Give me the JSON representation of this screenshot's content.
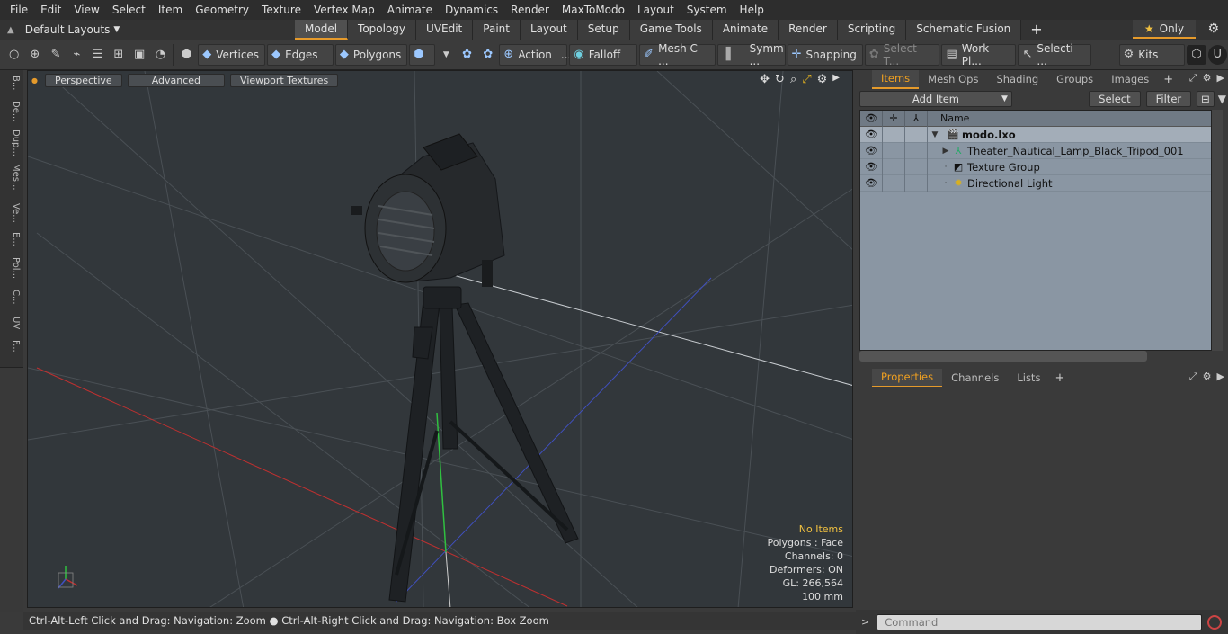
{
  "menu": [
    "File",
    "Edit",
    "View",
    "Select",
    "Item",
    "Geometry",
    "Texture",
    "Vertex Map",
    "Animate",
    "Dynamics",
    "Render",
    "MaxToModo",
    "Layout",
    "System",
    "Help"
  ],
  "layout_select": "Default Layouts",
  "mode_tabs": [
    "Model",
    "Topology",
    "UVEdit",
    "Paint",
    "Layout",
    "Setup",
    "Game Tools",
    "Animate",
    "Render",
    "Scripting",
    "Schematic Fusion"
  ],
  "active_mode_tab": "Model",
  "only_label": "Only",
  "toolbar": {
    "vertices": "Vertices",
    "edges": "Edges",
    "polygons": "Polygons",
    "action": "Action",
    "falloff": "Falloff",
    "mesh": "Mesh C ...",
    "symm": "Symm ...",
    "snapping": "Snapping",
    "select_t": "Select T...",
    "work_pl": "Work Pl...",
    "selecti": "Selecti ...",
    "kits": "Kits"
  },
  "left_tabs": [
    "B...",
    "De...",
    "Dup...",
    "Mes...",
    "Ve...",
    "E...",
    "Pol...",
    "C...",
    "UV",
    "F..."
  ],
  "viewport": {
    "perspective": "Perspective",
    "advanced": "Advanced",
    "textures": "Viewport Textures",
    "info": {
      "no_items": "No Items",
      "polygons": "Polygons : Face",
      "channels": "Channels: 0",
      "deformers": "Deformers: ON",
      "gl": "GL: 266,564",
      "scale": "100 mm"
    }
  },
  "status_bar": "Ctrl-Alt-Left Click and Drag: Navigation: Zoom ● Ctrl-Alt-Right Click and Drag: Navigation: Box Zoom",
  "items_panel": {
    "tabs": [
      "Items",
      "Mesh Ops",
      "Shading",
      "Groups",
      "Images"
    ],
    "active_tab": "Items",
    "add_item": "Add Item",
    "select": "Select",
    "filter": "Filter",
    "name_header": "Name",
    "tree": [
      {
        "label": "modo.lxo",
        "bold": true,
        "indent": 0
      },
      {
        "label": "Theater_Nautical_Lamp_Black_Tripod_001",
        "bold": false,
        "indent": 1
      },
      {
        "label": "Texture Group",
        "bold": false,
        "indent": 1
      },
      {
        "label": "Directional Light",
        "bold": false,
        "indent": 1
      }
    ]
  },
  "props_panel": {
    "tabs": [
      "Properties",
      "Channels",
      "Lists"
    ],
    "active_tab": "Properties"
  },
  "command_placeholder": "Command"
}
